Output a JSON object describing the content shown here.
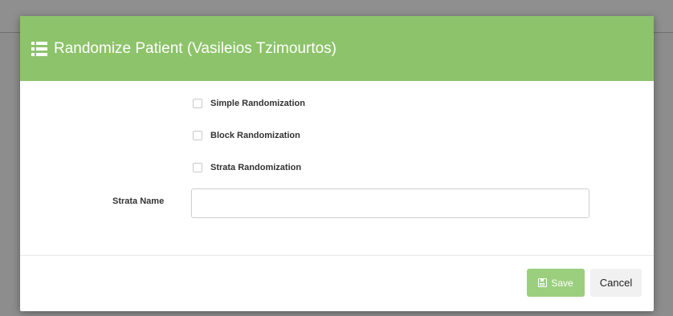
{
  "modal": {
    "title": "Randomize Patient (Vasileios Tzimourtos)",
    "header_icon": "list-icon",
    "options": [
      {
        "label": "Simple Randomization",
        "checked": false
      },
      {
        "label": "Block Randomization",
        "checked": false
      },
      {
        "label": "Strata Randomization",
        "checked": false
      }
    ],
    "strata": {
      "label": "Strata Name",
      "value": ""
    },
    "buttons": {
      "save": "Save",
      "cancel": "Cancel"
    }
  },
  "colors": {
    "header": "#8dc36a",
    "save_button": "#9bcf7e",
    "overlay": "#8d8d8d"
  }
}
